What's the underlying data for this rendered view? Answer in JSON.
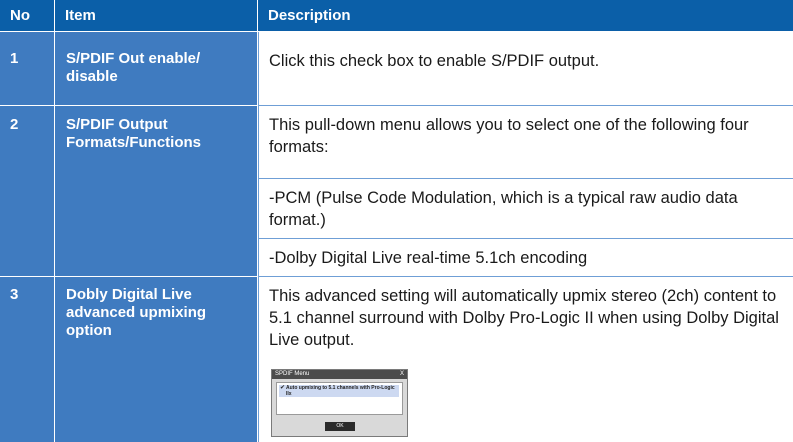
{
  "table": {
    "headers": {
      "no": "No",
      "item": "Item",
      "description": "Description"
    },
    "rows": [
      {
        "no": "1",
        "item": "S/PDIF Out enable/ disable",
        "description": [
          "Click this check box to enable S/PDIF output."
        ]
      },
      {
        "no": "2",
        "item": "S/PDIF Output Formats/Functions",
        "description": [
          "This pull-down menu allows you to select one of the following four formats:",
          "-PCM (Pulse Code Modulation, which is a typical raw audio data format.)",
          "-Dolby Digital Live real-time 5.1ch encoding"
        ]
      },
      {
        "no": "3",
        "item": "Dobly Digital Live advanced upmixing option",
        "description": [
          "This advanced setting will automatically upmix stereo (2ch) content to 5.1 channel surround with Dolby Pro-Logic II when using Dolby Digital Live output."
        ]
      }
    ]
  },
  "dialog": {
    "title": "SPDIF Menu",
    "close_label": "X",
    "checkbox_label": "Auto upmixing to 5.1 channels with Pro-Logic IIx",
    "ok_label": "OK"
  },
  "colors": {
    "header_bg": "#0b5fa8",
    "left_column_bg": "#3f7bc0",
    "text": "#1a1a1a"
  }
}
